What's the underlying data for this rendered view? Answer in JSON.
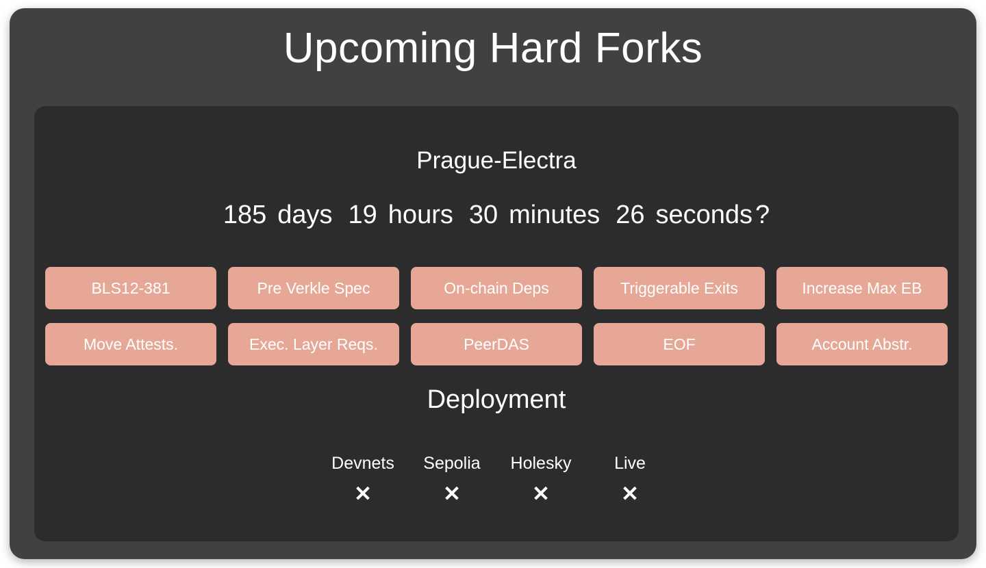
{
  "page": {
    "title": "Upcoming Hard Forks",
    "background_color": "#ffffff",
    "card_color": "#414141",
    "inner_card_color": "#2c2c2c",
    "accent_color": "#e6a796",
    "text_color": "#ffffff"
  },
  "fork": {
    "name": "Prague-Electra",
    "countdown": {
      "days_value": "185",
      "days_label": "days",
      "hours_value": "19",
      "hours_label": "hours",
      "minutes_value": "30",
      "minutes_label": "minutes",
      "seconds_value": "26",
      "seconds_label": "seconds",
      "suffix": "?"
    },
    "features": [
      [
        "BLS12-381",
        "Pre Verkle Spec",
        "On-chain Deps",
        "Triggerable Exits",
        "Increase Max EB"
      ],
      [
        "Move Attests.",
        "Exec. Layer Reqs.",
        "PeerDAS",
        "EOF",
        "Account Abstr."
      ]
    ]
  },
  "deployment": {
    "title": "Deployment",
    "stages": [
      {
        "label": "Devnets",
        "status": "✕"
      },
      {
        "label": "Sepolia",
        "status": "✕"
      },
      {
        "label": "Holesky",
        "status": "✕"
      },
      {
        "label": "Live",
        "status": "✕"
      }
    ]
  }
}
